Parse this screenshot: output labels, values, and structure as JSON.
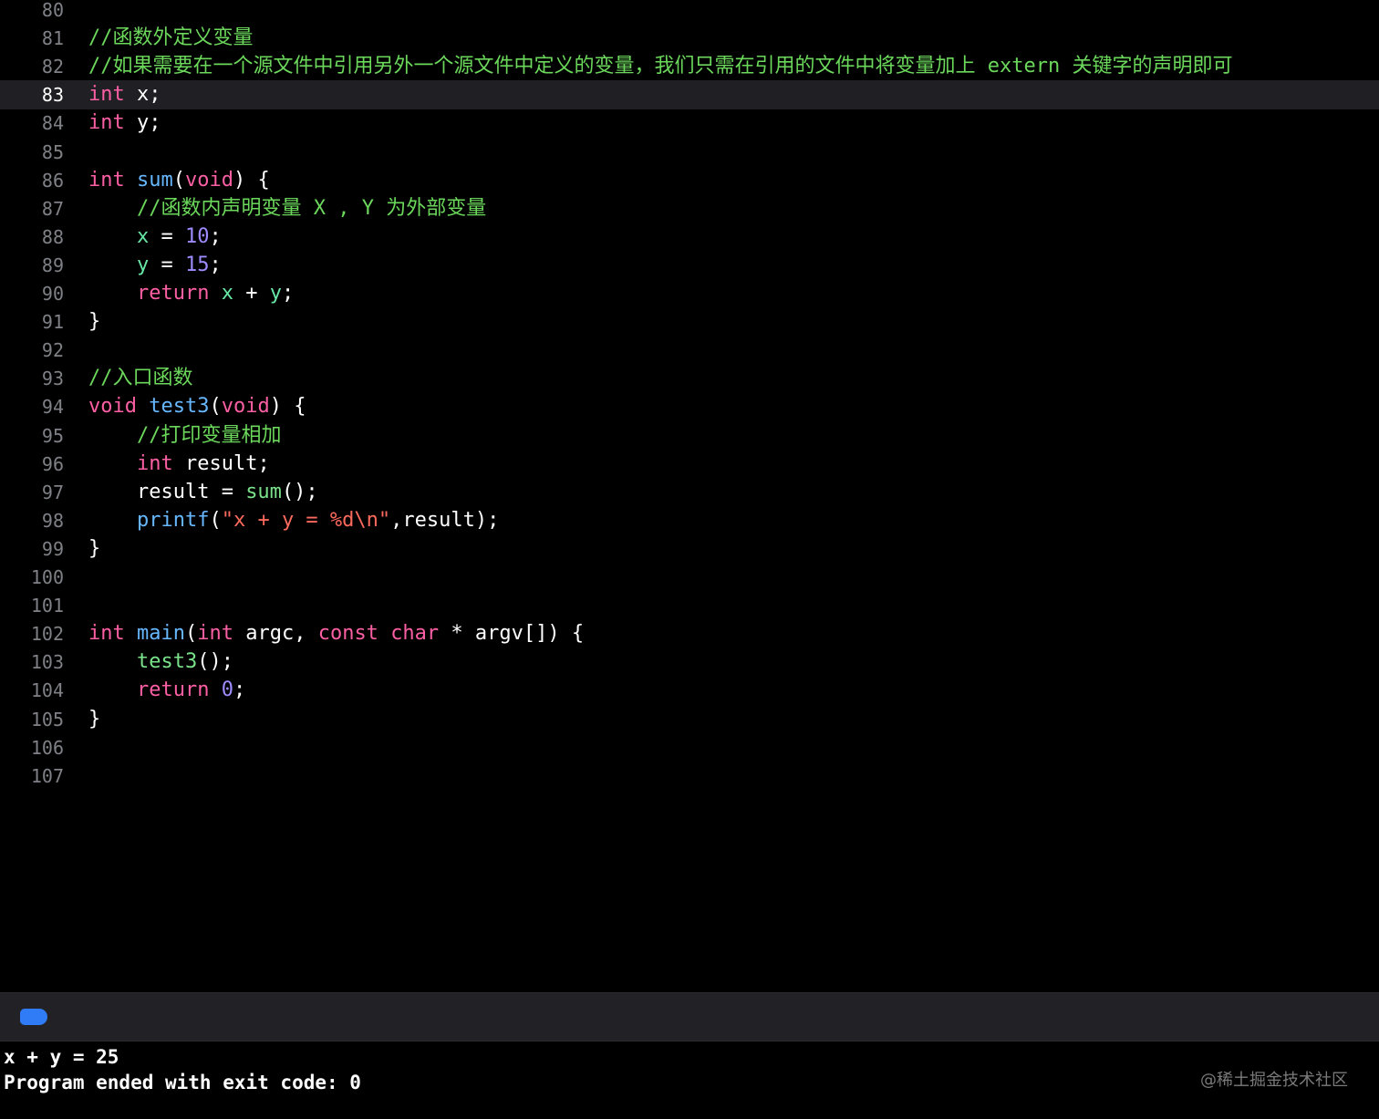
{
  "editor": {
    "current_line": 83,
    "lines": [
      {
        "num": "80",
        "tokens": []
      },
      {
        "num": "81",
        "tokens": [
          {
            "t": "comment",
            "text": "//函数外定义变量"
          }
        ]
      },
      {
        "num": "82",
        "tokens": [
          {
            "t": "comment",
            "text": "//如果需要在一个源文件中引用另外一个源文件中定义的变量，我们只需在引用的文件中将变量加上 extern 关键字的声明即可"
          }
        ]
      },
      {
        "num": "83",
        "tokens": [
          {
            "t": "kw",
            "text": "int"
          },
          {
            "t": "plain",
            "text": " x;"
          }
        ]
      },
      {
        "num": "84",
        "tokens": [
          {
            "t": "kw",
            "text": "int"
          },
          {
            "t": "plain",
            "text": " y;"
          }
        ]
      },
      {
        "num": "85",
        "tokens": []
      },
      {
        "num": "86",
        "tokens": [
          {
            "t": "kw",
            "text": "int"
          },
          {
            "t": "plain",
            "text": " "
          },
          {
            "t": "func",
            "text": "sum"
          },
          {
            "t": "plain",
            "text": "("
          },
          {
            "t": "kw",
            "text": "void"
          },
          {
            "t": "plain",
            "text": ") {"
          }
        ]
      },
      {
        "num": "87",
        "tokens": [
          {
            "t": "plain",
            "text": "    "
          },
          {
            "t": "comment",
            "text": "//函数内声明变量 X , Y 为外部变量"
          }
        ]
      },
      {
        "num": "88",
        "tokens": [
          {
            "t": "plain",
            "text": "    "
          },
          {
            "t": "var",
            "text": "x"
          },
          {
            "t": "plain",
            "text": " = "
          },
          {
            "t": "num",
            "text": "10"
          },
          {
            "t": "plain",
            "text": ";"
          }
        ]
      },
      {
        "num": "89",
        "tokens": [
          {
            "t": "plain",
            "text": "    "
          },
          {
            "t": "var",
            "text": "y"
          },
          {
            "t": "plain",
            "text": " = "
          },
          {
            "t": "num",
            "text": "15"
          },
          {
            "t": "plain",
            "text": ";"
          }
        ]
      },
      {
        "num": "90",
        "tokens": [
          {
            "t": "plain",
            "text": "    "
          },
          {
            "t": "kw",
            "text": "return"
          },
          {
            "t": "plain",
            "text": " "
          },
          {
            "t": "var",
            "text": "x"
          },
          {
            "t": "plain",
            "text": " + "
          },
          {
            "t": "var",
            "text": "y"
          },
          {
            "t": "plain",
            "text": ";"
          }
        ]
      },
      {
        "num": "91",
        "tokens": [
          {
            "t": "plain",
            "text": "}"
          }
        ]
      },
      {
        "num": "92",
        "tokens": []
      },
      {
        "num": "93",
        "tokens": [
          {
            "t": "comment",
            "text": "//入口函数"
          }
        ]
      },
      {
        "num": "94",
        "tokens": [
          {
            "t": "kw",
            "text": "void"
          },
          {
            "t": "plain",
            "text": " "
          },
          {
            "t": "func",
            "text": "test3"
          },
          {
            "t": "plain",
            "text": "("
          },
          {
            "t": "kw",
            "text": "void"
          },
          {
            "t": "plain",
            "text": ") {"
          }
        ]
      },
      {
        "num": "95",
        "tokens": [
          {
            "t": "plain",
            "text": "    "
          },
          {
            "t": "comment",
            "text": "//打印变量相加"
          }
        ]
      },
      {
        "num": "96",
        "tokens": [
          {
            "t": "plain",
            "text": "    "
          },
          {
            "t": "kw",
            "text": "int"
          },
          {
            "t": "plain",
            "text": " result;"
          }
        ]
      },
      {
        "num": "97",
        "tokens": [
          {
            "t": "plain",
            "text": "    result = "
          },
          {
            "t": "call",
            "text": "sum"
          },
          {
            "t": "plain",
            "text": "();"
          }
        ]
      },
      {
        "num": "98",
        "tokens": [
          {
            "t": "plain",
            "text": "    "
          },
          {
            "t": "func",
            "text": "printf"
          },
          {
            "t": "plain",
            "text": "("
          },
          {
            "t": "str",
            "text": "\"x + y = %d\\n\""
          },
          {
            "t": "plain",
            "text": ",result);"
          }
        ]
      },
      {
        "num": "99",
        "tokens": [
          {
            "t": "plain",
            "text": "}"
          }
        ]
      },
      {
        "num": "100",
        "tokens": []
      },
      {
        "num": "101",
        "tokens": []
      },
      {
        "num": "102",
        "tokens": [
          {
            "t": "kw",
            "text": "int"
          },
          {
            "t": "plain",
            "text": " "
          },
          {
            "t": "func",
            "text": "main"
          },
          {
            "t": "plain",
            "text": "("
          },
          {
            "t": "kw",
            "text": "int"
          },
          {
            "t": "plain",
            "text": " argc, "
          },
          {
            "t": "kw",
            "text": "const"
          },
          {
            "t": "plain",
            "text": " "
          },
          {
            "t": "kw",
            "text": "char"
          },
          {
            "t": "plain",
            "text": " * argv[]) {"
          }
        ]
      },
      {
        "num": "103",
        "tokens": [
          {
            "t": "plain",
            "text": "    "
          },
          {
            "t": "call",
            "text": "test3"
          },
          {
            "t": "plain",
            "text": "();"
          }
        ]
      },
      {
        "num": "104",
        "tokens": [
          {
            "t": "plain",
            "text": "    "
          },
          {
            "t": "kw",
            "text": "return"
          },
          {
            "t": "plain",
            "text": " "
          },
          {
            "t": "num",
            "text": "0"
          },
          {
            "t": "plain",
            "text": ";"
          }
        ]
      },
      {
        "num": "105",
        "tokens": [
          {
            "t": "plain",
            "text": "}"
          }
        ]
      },
      {
        "num": "106",
        "tokens": []
      },
      {
        "num": "107",
        "tokens": []
      }
    ]
  },
  "console": {
    "indicator_icon": "output-filter-icon",
    "accent_color": "#2f7cf6",
    "output_lines": [
      "x + y = 25",
      "Program ended with exit code: 0"
    ]
  },
  "watermark": "@稀土掘金技术社区"
}
